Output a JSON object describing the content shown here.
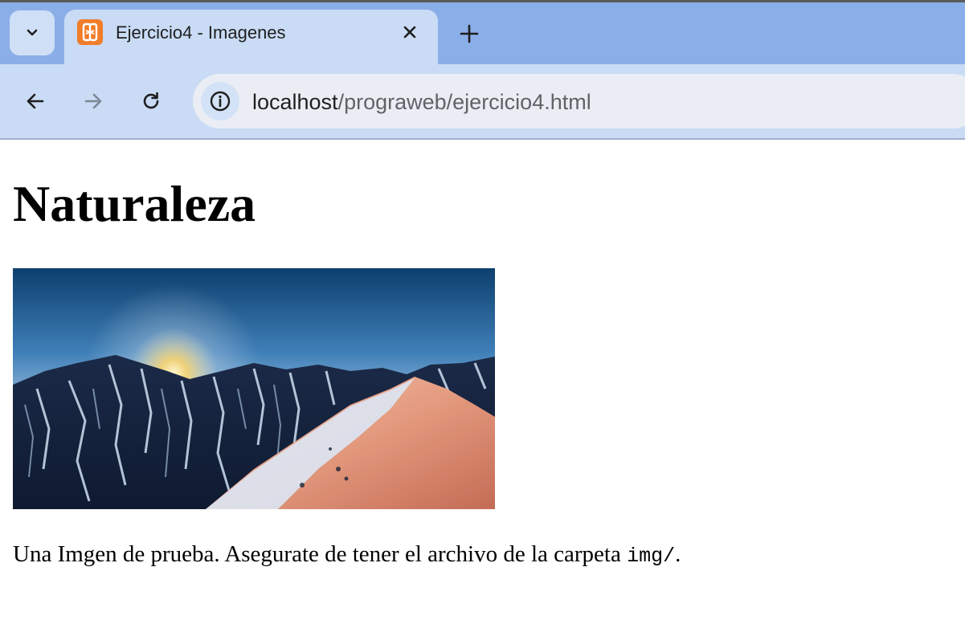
{
  "browser": {
    "tab": {
      "title": "Ejercicio4 - Imagenes",
      "favicon": "xampp-icon"
    },
    "address_bar": {
      "host": "localhost",
      "path": "/prograweb/ejercicio4.html"
    },
    "icons": {
      "tab_search": "chevron-down-icon",
      "close": "close-icon",
      "new_tab": "plus-icon",
      "back": "arrow-left-icon",
      "forward": "arrow-right-icon",
      "reload": "reload-icon",
      "site_info": "info-icon"
    },
    "colors": {
      "tabstrip": "#8aaee8",
      "toolbar": "#c9dbf5",
      "omnibox": "#eaeef4",
      "favicon": "#f07d2a"
    }
  },
  "page": {
    "heading": "Naturaleza",
    "image_alt": "mountain-sunrise-photo",
    "caption_text": "Una Imgen de prueba. Asegurate de tener el archivo de la carpeta ",
    "caption_code": "img/",
    "caption_end": "."
  }
}
